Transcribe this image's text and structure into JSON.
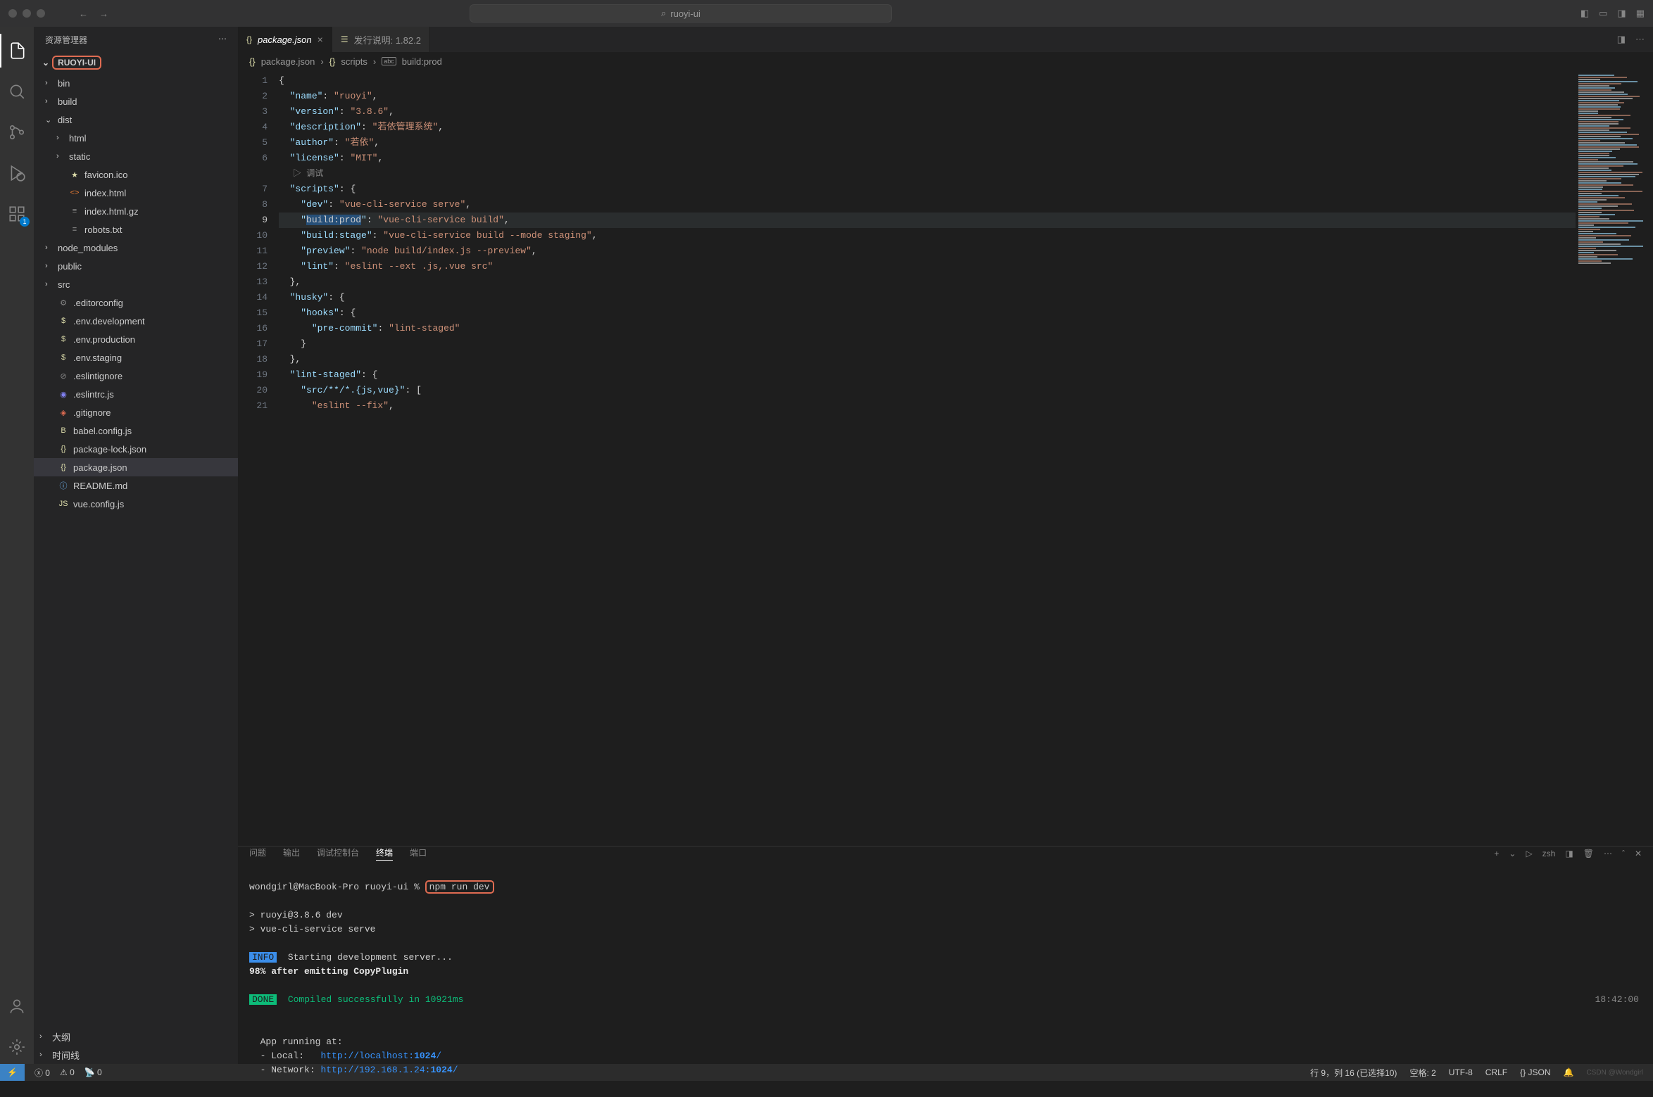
{
  "titlebar": {
    "search_text": "ruoyi-ui"
  },
  "activity": {
    "badge_extensions": "1"
  },
  "sidebar": {
    "header": "资源管理器",
    "project": "RUOYI-UI",
    "tree": [
      {
        "type": "folder",
        "open": false,
        "depth": 0,
        "name": "bin"
      },
      {
        "type": "folder",
        "open": false,
        "depth": 0,
        "name": "build"
      },
      {
        "type": "folder",
        "open": true,
        "depth": 0,
        "name": "dist"
      },
      {
        "type": "folder",
        "open": false,
        "depth": 1,
        "name": "html"
      },
      {
        "type": "folder",
        "open": false,
        "depth": 1,
        "name": "static"
      },
      {
        "type": "file",
        "depth": 1,
        "name": "favicon.ico",
        "icon": "star",
        "iconColor": "#dcdcaa"
      },
      {
        "type": "file",
        "depth": 1,
        "name": "index.html",
        "icon": "html",
        "iconColor": "#e37933"
      },
      {
        "type": "file",
        "depth": 1,
        "name": "index.html.gz",
        "icon": "zip",
        "iconColor": "#888"
      },
      {
        "type": "file",
        "depth": 1,
        "name": "robots.txt",
        "icon": "txt",
        "iconColor": "#888"
      },
      {
        "type": "folder",
        "open": false,
        "depth": 0,
        "name": "node_modules"
      },
      {
        "type": "folder",
        "open": false,
        "depth": 0,
        "name": "public"
      },
      {
        "type": "folder",
        "open": false,
        "depth": 0,
        "name": "src"
      },
      {
        "type": "file",
        "depth": 0,
        "name": ".editorconfig",
        "icon": "gear",
        "iconColor": "#888"
      },
      {
        "type": "file",
        "depth": 0,
        "name": ".env.development",
        "icon": "dollar",
        "iconColor": "#dcdcaa"
      },
      {
        "type": "file",
        "depth": 0,
        "name": ".env.production",
        "icon": "dollar",
        "iconColor": "#dcdcaa"
      },
      {
        "type": "file",
        "depth": 0,
        "name": ".env.staging",
        "icon": "dollar",
        "iconColor": "#dcdcaa"
      },
      {
        "type": "file",
        "depth": 0,
        "name": ".eslintignore",
        "icon": "ban",
        "iconColor": "#888"
      },
      {
        "type": "file",
        "depth": 0,
        "name": ".eslintrc.js",
        "icon": "eslint",
        "iconColor": "#8080f2"
      },
      {
        "type": "file",
        "depth": 0,
        "name": ".gitignore",
        "icon": "git",
        "iconColor": "#e06c52"
      },
      {
        "type": "file",
        "depth": 0,
        "name": "babel.config.js",
        "icon": "babel",
        "iconColor": "#dcdcaa"
      },
      {
        "type": "file",
        "depth": 0,
        "name": "package-lock.json",
        "icon": "json",
        "iconColor": "#dcdcaa"
      },
      {
        "type": "file",
        "depth": 0,
        "name": "package.json",
        "icon": "json",
        "iconColor": "#dcdcaa",
        "selected": true
      },
      {
        "type": "file",
        "depth": 0,
        "name": "README.md",
        "icon": "info",
        "iconColor": "#75beff"
      },
      {
        "type": "file",
        "depth": 0,
        "name": "vue.config.js",
        "icon": "js",
        "iconColor": "#dcdcaa"
      }
    ],
    "outline": "大纲",
    "timeline": "时间线"
  },
  "tabs": [
    {
      "label": "package.json",
      "icon": "{}",
      "active": true,
      "italic": true,
      "dirty": false,
      "close": true
    },
    {
      "label": "发行说明: 1.82.2",
      "icon": "note",
      "active": false
    }
  ],
  "breadcrumb": [
    "package.json",
    "scripts",
    "build:prod"
  ],
  "editor": {
    "debug_label": "调试",
    "lines": [
      {
        "n": 1,
        "parts": [
          [
            "{",
            "p"
          ]
        ]
      },
      {
        "n": 2,
        "parts": [
          [
            "  ",
            "p"
          ],
          [
            "\"name\"",
            "k"
          ],
          [
            ":",
            "p"
          ],
          [
            " ",
            "p"
          ],
          [
            "\"ruoyi\"",
            "s"
          ],
          [
            ",",
            "p"
          ]
        ]
      },
      {
        "n": 3,
        "parts": [
          [
            "  ",
            "p"
          ],
          [
            "\"version\"",
            "k"
          ],
          [
            ":",
            "p"
          ],
          [
            " ",
            "p"
          ],
          [
            "\"3.8.6\"",
            "s"
          ],
          [
            ",",
            "p"
          ]
        ]
      },
      {
        "n": 4,
        "parts": [
          [
            "  ",
            "p"
          ],
          [
            "\"description\"",
            "k"
          ],
          [
            ":",
            "p"
          ],
          [
            " ",
            "p"
          ],
          [
            "\"若依管理系统\"",
            "s"
          ],
          [
            ",",
            "p"
          ]
        ]
      },
      {
        "n": 5,
        "parts": [
          [
            "  ",
            "p"
          ],
          [
            "\"author\"",
            "k"
          ],
          [
            ":",
            "p"
          ],
          [
            " ",
            "p"
          ],
          [
            "\"若依\"",
            "s"
          ],
          [
            ",",
            "p"
          ]
        ]
      },
      {
        "n": 6,
        "parts": [
          [
            "  ",
            "p"
          ],
          [
            "\"license\"",
            "k"
          ],
          [
            ":",
            "p"
          ],
          [
            " ",
            "p"
          ],
          [
            "\"MIT\"",
            "s"
          ],
          [
            ",",
            "p"
          ]
        ]
      },
      {
        "n": "debug"
      },
      {
        "n": 7,
        "parts": [
          [
            "  ",
            "p"
          ],
          [
            "\"scripts\"",
            "k"
          ],
          [
            ":",
            "p"
          ],
          [
            " {",
            "p"
          ]
        ]
      },
      {
        "n": 8,
        "parts": [
          [
            "    ",
            "p"
          ],
          [
            "\"dev\"",
            "k"
          ],
          [
            ":",
            "p"
          ],
          [
            " ",
            "p"
          ],
          [
            "\"vue-cli-service serve\"",
            "s"
          ],
          [
            ",",
            "p"
          ]
        ]
      },
      {
        "n": 9,
        "hl": true,
        "parts": [
          [
            "    ",
            "p"
          ],
          [
            "\"",
            "k"
          ],
          [
            "build:prod",
            "sel"
          ],
          [
            "\"",
            "k"
          ],
          [
            ":",
            "p"
          ],
          [
            " ",
            "p"
          ],
          [
            "\"vue-cli-service build\"",
            "s"
          ],
          [
            ",",
            "p"
          ]
        ]
      },
      {
        "n": 10,
        "parts": [
          [
            "    ",
            "p"
          ],
          [
            "\"build:stage\"",
            "k"
          ],
          [
            ":",
            "p"
          ],
          [
            " ",
            "p"
          ],
          [
            "\"vue-cli-service build --mode staging\"",
            "s"
          ],
          [
            ",",
            "p"
          ]
        ]
      },
      {
        "n": 11,
        "parts": [
          [
            "    ",
            "p"
          ],
          [
            "\"preview\"",
            "k"
          ],
          [
            ":",
            "p"
          ],
          [
            " ",
            "p"
          ],
          [
            "\"node build/index.js --preview\"",
            "s"
          ],
          [
            ",",
            "p"
          ]
        ]
      },
      {
        "n": 12,
        "parts": [
          [
            "    ",
            "p"
          ],
          [
            "\"lint\"",
            "k"
          ],
          [
            ":",
            "p"
          ],
          [
            " ",
            "p"
          ],
          [
            "\"eslint --ext .js,.vue src\"",
            "s"
          ]
        ]
      },
      {
        "n": 13,
        "parts": [
          [
            "  },",
            "p"
          ]
        ]
      },
      {
        "n": 14,
        "parts": [
          [
            "  ",
            "p"
          ],
          [
            "\"husky\"",
            "k"
          ],
          [
            ":",
            "p"
          ],
          [
            " {",
            "p"
          ]
        ]
      },
      {
        "n": 15,
        "parts": [
          [
            "    ",
            "p"
          ],
          [
            "\"hooks\"",
            "k"
          ],
          [
            ":",
            "p"
          ],
          [
            " {",
            "p"
          ]
        ]
      },
      {
        "n": 16,
        "parts": [
          [
            "      ",
            "p"
          ],
          [
            "\"pre-commit\"",
            "k"
          ],
          [
            ":",
            "p"
          ],
          [
            " ",
            "p"
          ],
          [
            "\"lint-staged\"",
            "s"
          ]
        ]
      },
      {
        "n": 17,
        "parts": [
          [
            "    }",
            "p"
          ]
        ]
      },
      {
        "n": 18,
        "parts": [
          [
            "  },",
            "p"
          ]
        ]
      },
      {
        "n": 19,
        "parts": [
          [
            "  ",
            "p"
          ],
          [
            "\"lint-staged\"",
            "k"
          ],
          [
            ":",
            "p"
          ],
          [
            " {",
            "p"
          ]
        ]
      },
      {
        "n": 20,
        "parts": [
          [
            "    ",
            "p"
          ],
          [
            "\"src/**/*.{js,vue}\"",
            "k"
          ],
          [
            ":",
            "p"
          ],
          [
            " [",
            "p"
          ]
        ]
      },
      {
        "n": 21,
        "parts": [
          [
            "      ",
            "p"
          ],
          [
            "\"eslint --fix\"",
            "s"
          ],
          [
            ",",
            "p"
          ]
        ]
      }
    ]
  },
  "panel": {
    "tabs": [
      "问题",
      "输出",
      "调试控制台",
      "终端",
      "端口"
    ],
    "active_tab": "终端",
    "shell": "zsh",
    "prompt_user": "wondgirl@MacBook-Pro",
    "prompt_dir": "ruoyi-ui",
    "command": "npm run dev",
    "out1": "> ruoyi@3.8.6 dev",
    "out2": "> vue-cli-service serve",
    "info_label": "INFO",
    "info_text": "Starting development server...",
    "progress": "98% after emitting CopyPlugin",
    "done_label": "DONE",
    "done_text": "Compiled successfully in 10921ms",
    "done_time": "18:42:00",
    "app_running": "App running at:",
    "local_label": "- Local:   ",
    "local_url_prefix": "http://localhost:",
    "local_port": "1024",
    "local_suffix": "/",
    "network_label": "- Network: ",
    "network_url_prefix": "http://192.168.1.24:",
    "network_port": "1024",
    "network_suffix": "/"
  },
  "statusbar": {
    "errors": "0",
    "warnings": "0",
    "port": "0",
    "cursor": "行 9，列 16 (已选择10)",
    "spaces": "空格: 2",
    "encoding": "UTF-8",
    "eol": "CRLF",
    "lang": "JSON",
    "lang_icon": "{}",
    "watermark": "CSDN @Wondgirl"
  }
}
